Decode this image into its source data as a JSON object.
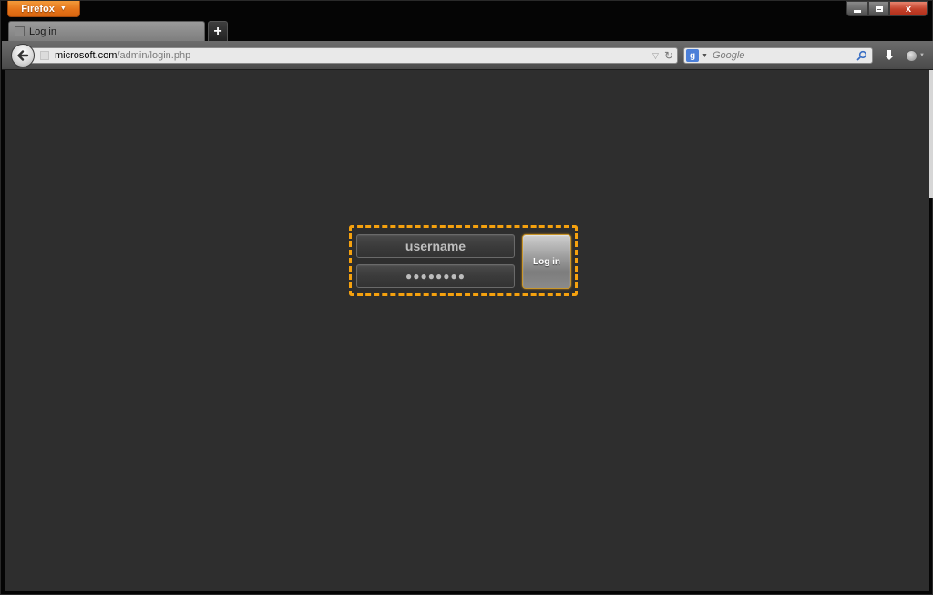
{
  "browser": {
    "menu_label": "Firefox",
    "tabs": [
      {
        "label": "Log in"
      }
    ],
    "new_tab_label": "+",
    "url": {
      "domain": "microsoft.com",
      "path": "/admin/login.php"
    },
    "search": {
      "engine": "google-icon",
      "engine_letter": "g",
      "placeholder": "Google"
    },
    "window_controls": {
      "close_label": "x"
    }
  },
  "login": {
    "username_placeholder": "username",
    "password_value": "●●●●●●●●",
    "button_label": "Log in"
  },
  "colors": {
    "accent_orange": "#f5a10e",
    "page_background": "#2e2e2e",
    "firefox_orange": "#e5741a"
  }
}
